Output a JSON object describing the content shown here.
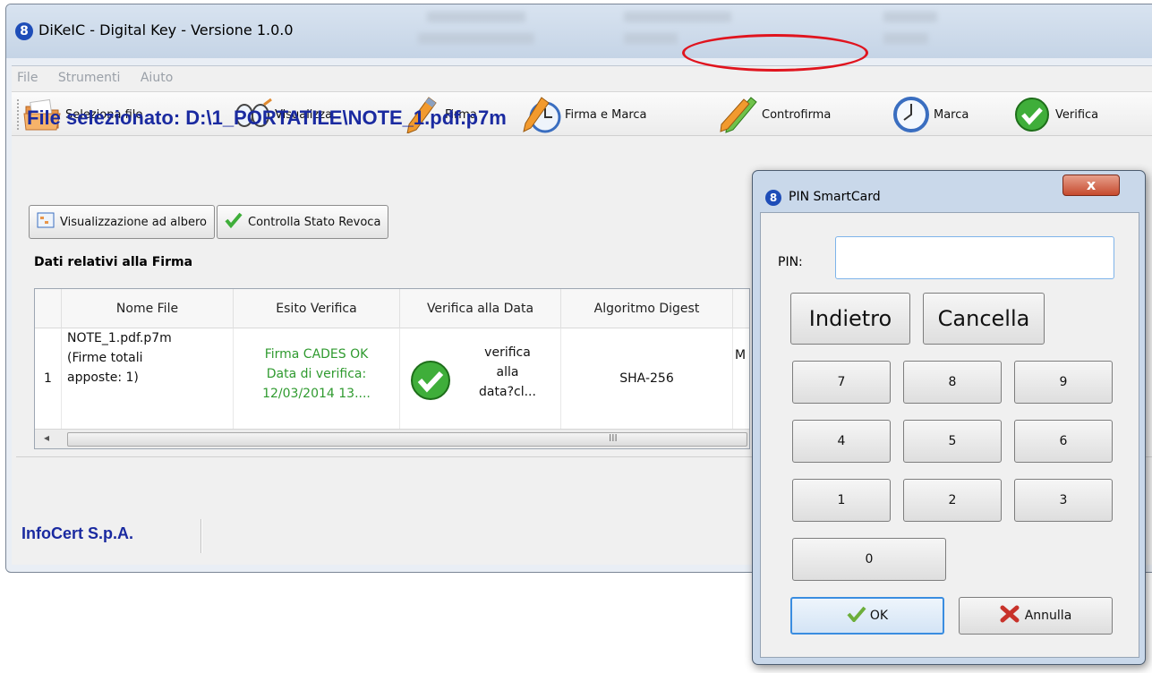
{
  "window": {
    "title": "DiKeIC - Digital Key - Versione 1.0.0",
    "logo_glyph": "8"
  },
  "menu": [
    "File",
    "Strumenti",
    "Aiuto"
  ],
  "toolbar": [
    {
      "label": "Seleziona file",
      "icon": "folder-icon"
    },
    {
      "label": "Visualizza",
      "icon": "glasses-icon"
    },
    {
      "label": "Firma",
      "icon": "pen-icon"
    },
    {
      "label": "Firma e Marca",
      "icon": "pen-clock-icon"
    },
    {
      "label": "Controfirma",
      "icon": "green-pen-icon"
    },
    {
      "label": "Marca",
      "icon": "clock-icon"
    },
    {
      "label": "Verifica",
      "icon": "check-icon"
    }
  ],
  "file_heading": "File selezionato: D:\\1_PORTATILE\\NOTE_1.pdf.p7m",
  "buttons": {
    "tree_view": "Visualizzazione ad albero",
    "revocation": "Controlla Stato Revoca"
  },
  "section_label": "Dati relativi alla Firma",
  "grid": {
    "columns": [
      "Nome File",
      "Esito Verifica",
      "Verifica alla Data",
      "Algoritmo Digest"
    ],
    "row": {
      "index": "1",
      "file": [
        "NOTE_1.pdf.p7m",
        "(Firme totali",
        "apposte: 1)"
      ],
      "esito": [
        "Firma CADES OK",
        "Data di verifica:",
        "12/03/2014  13...."
      ],
      "verifica_data": [
        "verifica",
        "alla",
        "data?cl..."
      ],
      "digest": "SHA-256",
      "clipped": "M"
    },
    "scroll_marker": "III"
  },
  "status": "InfoCert S.p.A.",
  "pin_dialog": {
    "title": "PIN SmartCard",
    "close_glyph": "x",
    "pin_label": "PIN:",
    "pin_value": "",
    "back": "Indietro",
    "clear": "Cancella",
    "keys": [
      "7",
      "8",
      "9",
      "4",
      "5",
      "6",
      "1",
      "2",
      "3",
      "0"
    ],
    "ok": "OK",
    "cancel": "Annulla"
  },
  "colors": {
    "heading_blue": "#1a2aa0",
    "success_green": "#2f9a2f",
    "highlight_red": "#e0141e"
  }
}
